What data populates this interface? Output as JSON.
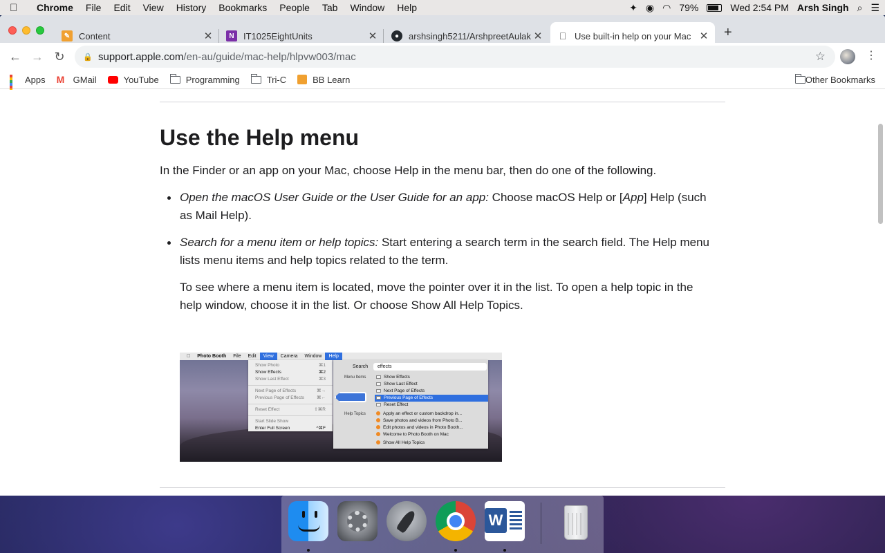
{
  "menubar": {
    "app": "Chrome",
    "items": [
      "File",
      "Edit",
      "View",
      "History",
      "Bookmarks",
      "People",
      "Tab",
      "Window",
      "Help"
    ],
    "battery": "79%",
    "clock": "Wed 2:54 PM",
    "user": "Arsh Singh"
  },
  "tabs": [
    {
      "title": "Content",
      "favicon": "pencil-icon",
      "color": "#f0a030"
    },
    {
      "title": "IT1025EightUnits",
      "favicon": "onenote-icon",
      "color": "#7b2fa8"
    },
    {
      "title": "arshsingh5211/ArshpreetAulakh",
      "favicon": "github-icon",
      "color": "#24292e"
    },
    {
      "title": "Use built-in help on your Mac",
      "favicon": "apple-icon",
      "color": "#555555"
    }
  ],
  "omnibox": {
    "host": "support.apple.com",
    "path": "/en-au/guide/mac-help/hlpvw003/mac"
  },
  "bookmarks": {
    "items": [
      "Apps",
      "GMail",
      "YouTube",
      "Programming",
      "Tri-C",
      "BB Learn"
    ],
    "other": "Other Bookmarks"
  },
  "page": {
    "title": "Use the Help menu",
    "intro": "In the Finder or an app on your Mac, choose Help in the menu bar, then do one of the following.",
    "bullet1_italic": "Open the macOS User Guide or the User Guide for an app:",
    "bullet1_a": " Choose macOS Help or [",
    "bullet1_app": "App",
    "bullet1_b": "] Help (such as Mail Help).",
    "bullet2_italic": "Search for a menu item or help topics:",
    "bullet2_text": " Start entering a search term in the search field. The Help menu lists menu items and help topics related to the term.",
    "bullet2_followup": "To see where a menu item is located, move the pointer over it in the list. To open a help topic in the help window, choose it in the list. Or choose Show All Help Topics."
  },
  "illustration": {
    "menubar": [
      "Photo Booth",
      "File",
      "Edit",
      "View",
      "Camera",
      "Window",
      "Help"
    ],
    "view_menu": [
      {
        "label": "Show Photo",
        "key": "⌘1",
        "enabled": false
      },
      {
        "label": "Show Effects",
        "key": "⌘2",
        "enabled": true
      },
      {
        "label": "Show Last Effect",
        "key": "⌘3",
        "enabled": false
      },
      {
        "label": "Next Page of Effects",
        "key": "⌘→",
        "enabled": false
      },
      {
        "label": "Previous Page of Effects",
        "key": "⌘←",
        "enabled": false
      },
      {
        "label": "Reset Effect",
        "key": "⇧⌘R",
        "enabled": false
      },
      {
        "label": "Start Slide Show",
        "key": "",
        "enabled": false
      },
      {
        "label": "Enter Full Screen",
        "key": "^⌘F",
        "enabled": true
      }
    ],
    "search_label": "Search",
    "search_value": "effects",
    "menu_items_label": "Menu Items",
    "menu_items": [
      "Show Effects",
      "Show Last Effect",
      "Next Page of Effects",
      "Previous Page of Effects",
      "Reset Effect"
    ],
    "help_topics_label": "Help Topics",
    "help_topics": [
      "Apply an effect or custom backdrop in...",
      "Save photos and videos from Photo B...",
      "Edit photos and videos in Photo Booth...",
      "Welcome to Photo Booth on Mac",
      "Show All Help Topics"
    ]
  },
  "dock": [
    "Finder",
    "System Preferences",
    "Launchpad",
    "Google Chrome",
    "Microsoft Word",
    "Trash"
  ]
}
